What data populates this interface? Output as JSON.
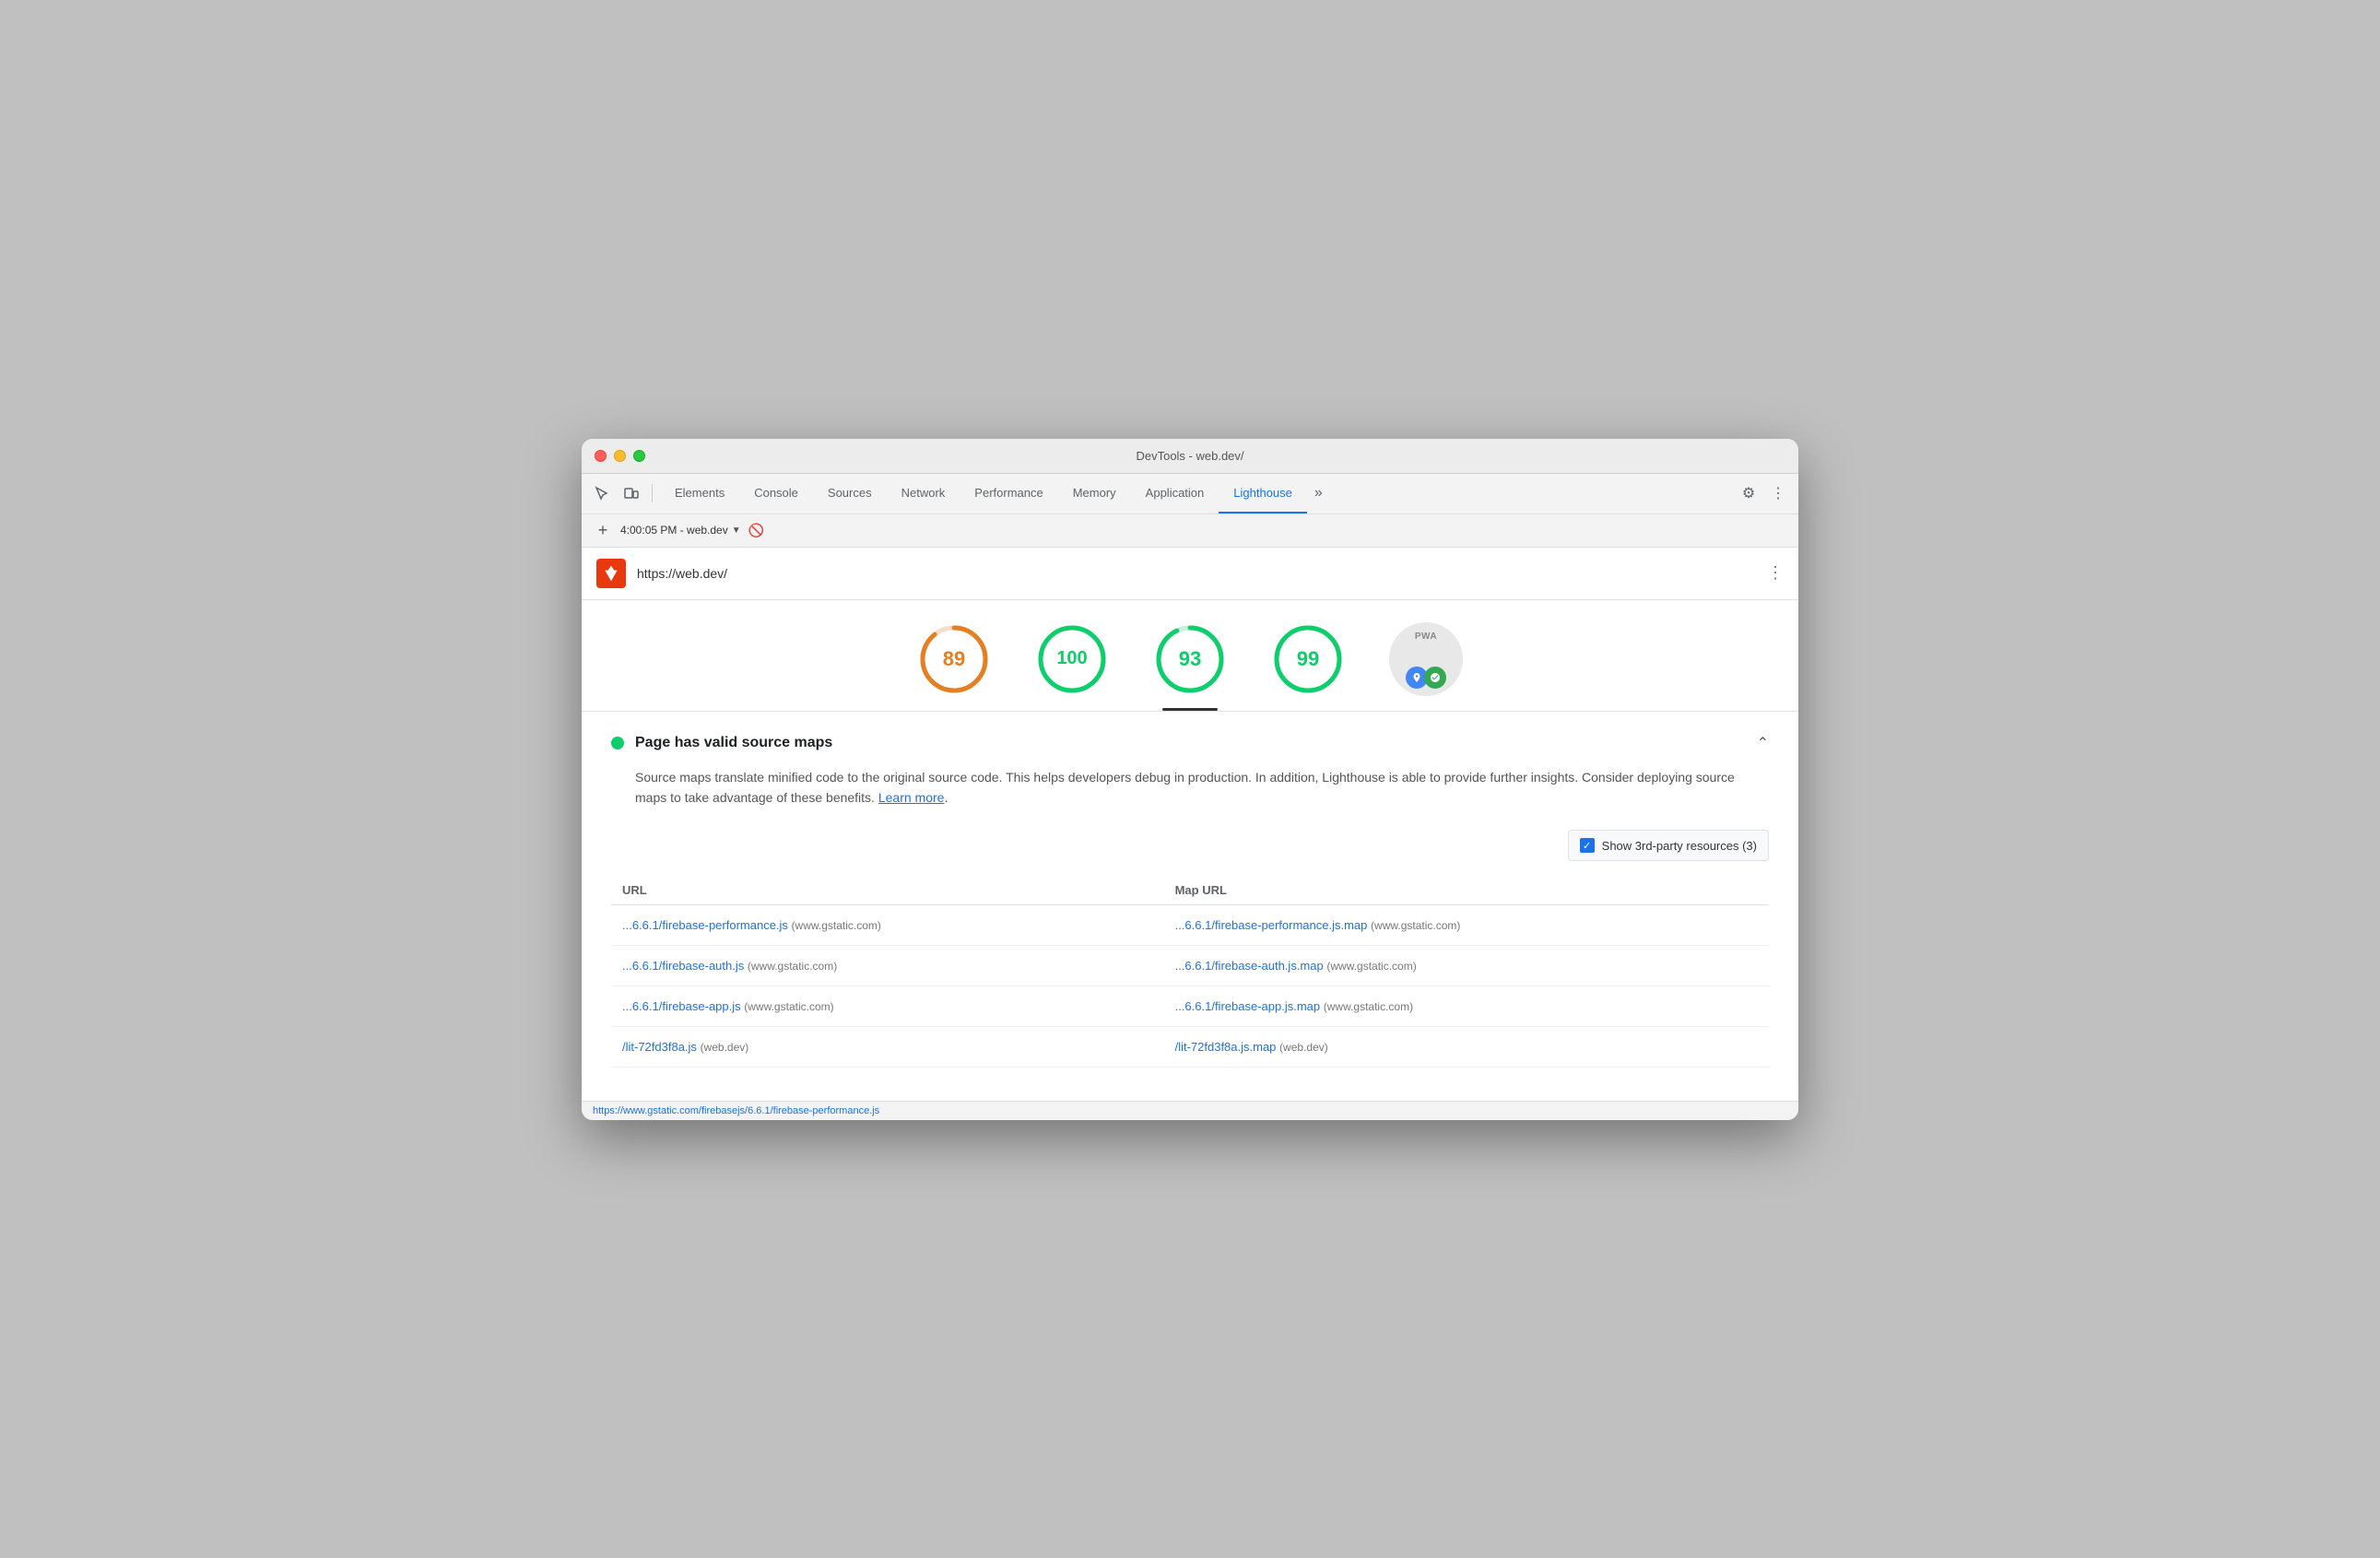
{
  "window": {
    "title": "DevTools - web.dev/"
  },
  "toolbar": {
    "tabs": [
      {
        "id": "elements",
        "label": "Elements",
        "active": false
      },
      {
        "id": "console",
        "label": "Console",
        "active": false
      },
      {
        "id": "sources",
        "label": "Sources",
        "active": false
      },
      {
        "id": "network",
        "label": "Network",
        "active": false
      },
      {
        "id": "performance",
        "label": "Performance",
        "active": false
      },
      {
        "id": "memory",
        "label": "Memory",
        "active": false
      },
      {
        "id": "application",
        "label": "Application",
        "active": false
      },
      {
        "id": "lighthouse",
        "label": "Lighthouse",
        "active": true
      }
    ],
    "more_tabs_icon": "»",
    "settings_icon": "⚙",
    "menu_icon": "⋮"
  },
  "secondary_toolbar": {
    "add_icon": "+",
    "tab_label": "4:00:05 PM - web.dev",
    "no_entry_icon": "🚫"
  },
  "url_bar": {
    "url": "https://web.dev/",
    "more_icon": "⋮"
  },
  "scores": [
    {
      "id": "performance",
      "value": "89",
      "color": "#e67e22",
      "active": false,
      "ring_color": "#e67e22",
      "track_color": "#f5ddc8"
    },
    {
      "id": "accessibility",
      "value": "100",
      "color": "#0cce6b",
      "active": false,
      "ring_color": "#0cce6b",
      "track_color": "#c8f0da"
    },
    {
      "id": "best-practices",
      "value": "93",
      "color": "#0cce6b",
      "active": true,
      "ring_color": "#0cce6b",
      "track_color": "#c8f0da"
    },
    {
      "id": "seo",
      "value": "99",
      "color": "#0cce6b",
      "active": false,
      "ring_color": "#0cce6b",
      "track_color": "#c8f0da"
    }
  ],
  "pwa": {
    "label": "PWA",
    "badge_color_1": "#4285f4",
    "badge_color_2": "#34a853"
  },
  "audit": {
    "status": "pass",
    "title": "Page has valid source maps",
    "description_part1": "Source maps translate minified code to the original source code. This helps developers debug in production. In addition, Lighthouse is able to provide further insights. Consider deploying source maps to take advantage of these benefits.",
    "learn_more_text": "Learn more",
    "description_end": ".",
    "checkbox_label": "Show 3rd-party resources (3)",
    "table": {
      "columns": [
        "URL",
        "Map URL"
      ],
      "rows": [
        {
          "url": "...6.6.1/firebase-performance.js",
          "url_domain": "(www.gstatic.com)",
          "map_url": "...6.6.1/firebase-performance.js.map",
          "map_domain": "(www.gstatic.com)"
        },
        {
          "url": "...6.6.1/firebase-auth.js",
          "url_domain": "(www.gstatic.com)",
          "map_url": "...6.6.1/firebase-auth.js.map",
          "map_domain": "(www.gstatic.com)"
        },
        {
          "url": "...6.6.1/firebase-app.js",
          "url_domain": "(www.gstatic.com)",
          "map_url": "...6.6.1/firebase-app.js.map",
          "map_domain": "(www.gstatic.com)"
        },
        {
          "url": "/lit-72fd3f8a.js",
          "url_domain": "(web.dev)",
          "map_url": "/lit-72fd3f8a.js.map",
          "map_domain": "(web.dev)"
        }
      ]
    }
  },
  "status_bar": {
    "url": "https://www.gstatic.com/firebasejs/6.6.1/firebase-performance.js"
  }
}
